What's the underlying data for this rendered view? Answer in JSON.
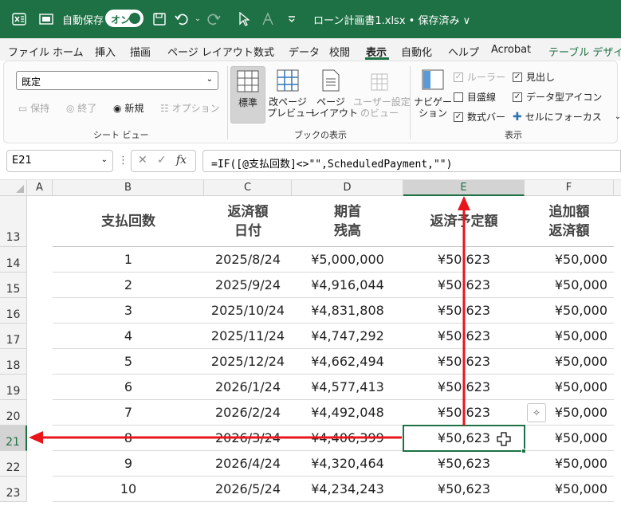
{
  "titlebar": {
    "autosave_label": "自動保存",
    "autosave_state": "オン",
    "file_title": "ローン計画書1.xlsx • 保存済み ∨"
  },
  "tabs": [
    "ファイル",
    "ホーム",
    "挿入",
    "描画",
    "ページ レイアウト",
    "数式",
    "データ",
    "校閲",
    "表示",
    "自動化",
    "ヘルプ",
    "Acrobat",
    "テーブル デザイン"
  ],
  "active_tab": "表示",
  "ribbon": {
    "sheet_view_select": "既定",
    "sheet_view_buttons": [
      "保持",
      "終了",
      "新規",
      "オプション"
    ],
    "sheet_view_group": "シート ビュー",
    "workbook_views": [
      {
        "line1": "標準",
        "line2": ""
      },
      {
        "line1": "改ページ",
        "line2": "プレビュー"
      },
      {
        "line1": "ページ",
        "line2": "レイアウト"
      },
      {
        "line1": "ユーザー設定",
        "line2": "のビュー"
      }
    ],
    "workbook_views_group": "ブックの表示",
    "navigation": {
      "line1": "ナビゲー",
      "line2": "ション"
    },
    "show_checks": {
      "ruler": "ルーラー",
      "gridlines": "目盛線",
      "formula_bar": "数式バー",
      "headings": "見出し",
      "data_type_icons": "データ型アイコン",
      "focus_cell": "セルにフォーカス"
    },
    "show_group": "表示"
  },
  "formula_bar": {
    "name_box": "E21",
    "fx": "fx",
    "formula": "=IF([@支払回数]<>\"\",ScheduledPayment,\"\")"
  },
  "columns": [
    "A",
    "B",
    "C",
    "D",
    "E",
    "F"
  ],
  "selected_column": "E",
  "header_row": {
    "row": "13",
    "b": "支払回数",
    "c1": "返済額",
    "c2": "日付",
    "d1": "期首",
    "d2": "残高",
    "e": "返済予定額",
    "f1": "追加額",
    "f2": "返済額"
  },
  "rows": [
    {
      "row": "14",
      "b": "1",
      "c": "2025/8/24",
      "d": "¥5,000,000",
      "e": "¥50,623",
      "f": "¥50,000"
    },
    {
      "row": "15",
      "b": "2",
      "c": "2025/9/24",
      "d": "¥4,916,044",
      "e": "¥50,623",
      "f": "¥50,000"
    },
    {
      "row": "16",
      "b": "3",
      "c": "2025/10/24",
      "d": "¥4,831,808",
      "e": "¥50,623",
      "f": "¥50,000"
    },
    {
      "row": "17",
      "b": "4",
      "c": "2025/11/24",
      "d": "¥4,747,292",
      "e": "¥50,623",
      "f": "¥50,000"
    },
    {
      "row": "18",
      "b": "5",
      "c": "2025/12/24",
      "d": "¥4,662,494",
      "e": "¥50,623",
      "f": "¥50,000"
    },
    {
      "row": "19",
      "b": "6",
      "c": "2026/1/24",
      "d": "¥4,577,413",
      "e": "¥50,623",
      "f": "¥50,000"
    },
    {
      "row": "20",
      "b": "7",
      "c": "2026/2/24",
      "d": "¥4,492,048",
      "e": "¥50,623",
      "f": "¥50,000"
    },
    {
      "row": "21",
      "b": "8",
      "c": "2026/3/24",
      "d": "¥4,406,399",
      "e": "¥50,623",
      "f": "¥50,000"
    },
    {
      "row": "22",
      "b": "9",
      "c": "2026/4/24",
      "d": "¥4,320,464",
      "e": "¥50,623",
      "f": "¥50,000"
    },
    {
      "row": "23",
      "b": "10",
      "c": "2026/5/24",
      "d": "¥4,234,243",
      "e": "¥50,623",
      "f": "¥50,000"
    }
  ],
  "selected_row": "21",
  "colors": {
    "excel_green": "#1e7145",
    "arrow_red": "#e8151b"
  }
}
